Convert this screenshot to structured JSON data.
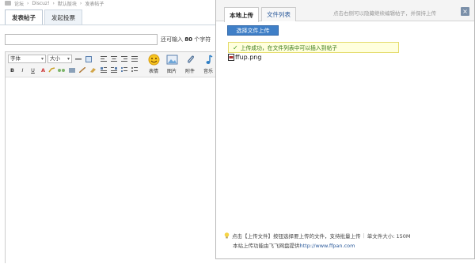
{
  "breadcrumb": [
    "论坛",
    "Discuz!",
    "默认版块",
    "发表帖子"
  ],
  "tabs": [
    "发表帖子",
    "发起投票"
  ],
  "subject": {
    "value": "",
    "hint_prefix": "还可输入",
    "hint_count": "80",
    "hint_suffix": "个字符"
  },
  "toolbar": {
    "font_family": "字体",
    "font_size": "大小",
    "big_buttons": [
      "表情",
      "图片",
      "附件",
      "音乐"
    ]
  },
  "dialog": {
    "tabs": [
      "本地上传",
      "文件列表"
    ],
    "hint": "点击右侧可以隐藏继续编辑帖子，并保持上传",
    "close": "×",
    "upload_button": "选择文件上传",
    "success_message": "上传成功，在文件列表中可以插入到帖子",
    "file_name": "ffup.png",
    "footer_line1": "点击【上传文件】按钮选择要上传的文件，支持批量上传",
    "footer_size": "单文件大小: 150M",
    "footer_line2_prefix": "本站上传功能由飞飞网盘提供",
    "footer_link": "http://www.ffpan.com"
  },
  "colors": {
    "accent": "#3f7fc7",
    "success_bg": "#ffffdd",
    "success_text": "#3a7a18"
  }
}
